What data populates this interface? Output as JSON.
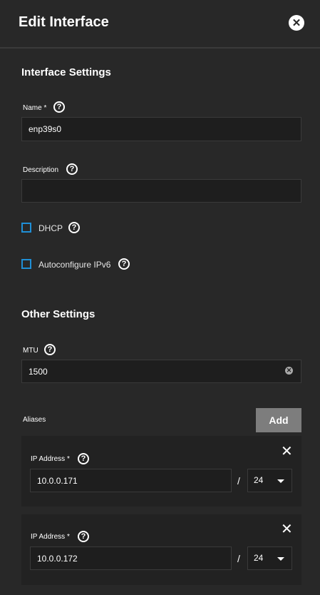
{
  "header": {
    "title": "Edit Interface"
  },
  "interface_settings": {
    "title": "Interface Settings",
    "name_label": "Name *",
    "name_value": "enp39s0",
    "description_label": "Description",
    "description_value": "",
    "dhcp_label": "DHCP",
    "dhcp_checked": false,
    "ipv6_label": "Autoconfigure IPv6",
    "ipv6_checked": false
  },
  "other_settings": {
    "title": "Other Settings",
    "mtu_label": "MTU",
    "mtu_value": "1500"
  },
  "aliases": {
    "label": "Aliases",
    "add_label": "Add",
    "items": [
      {
        "ip_label": "IP Address *",
        "ip_value": "10.0.0.171",
        "separator": "/",
        "netmask": "24"
      },
      {
        "ip_label": "IP Address *",
        "ip_value": "10.0.0.172",
        "separator": "/",
        "netmask": "24"
      }
    ]
  },
  "icons": {
    "help": "?",
    "close": "✕",
    "clear": "✕",
    "remove": "✕"
  },
  "colors": {
    "background": "#282828",
    "accent": "#1f8fd6",
    "button": "#7d7d7d"
  }
}
